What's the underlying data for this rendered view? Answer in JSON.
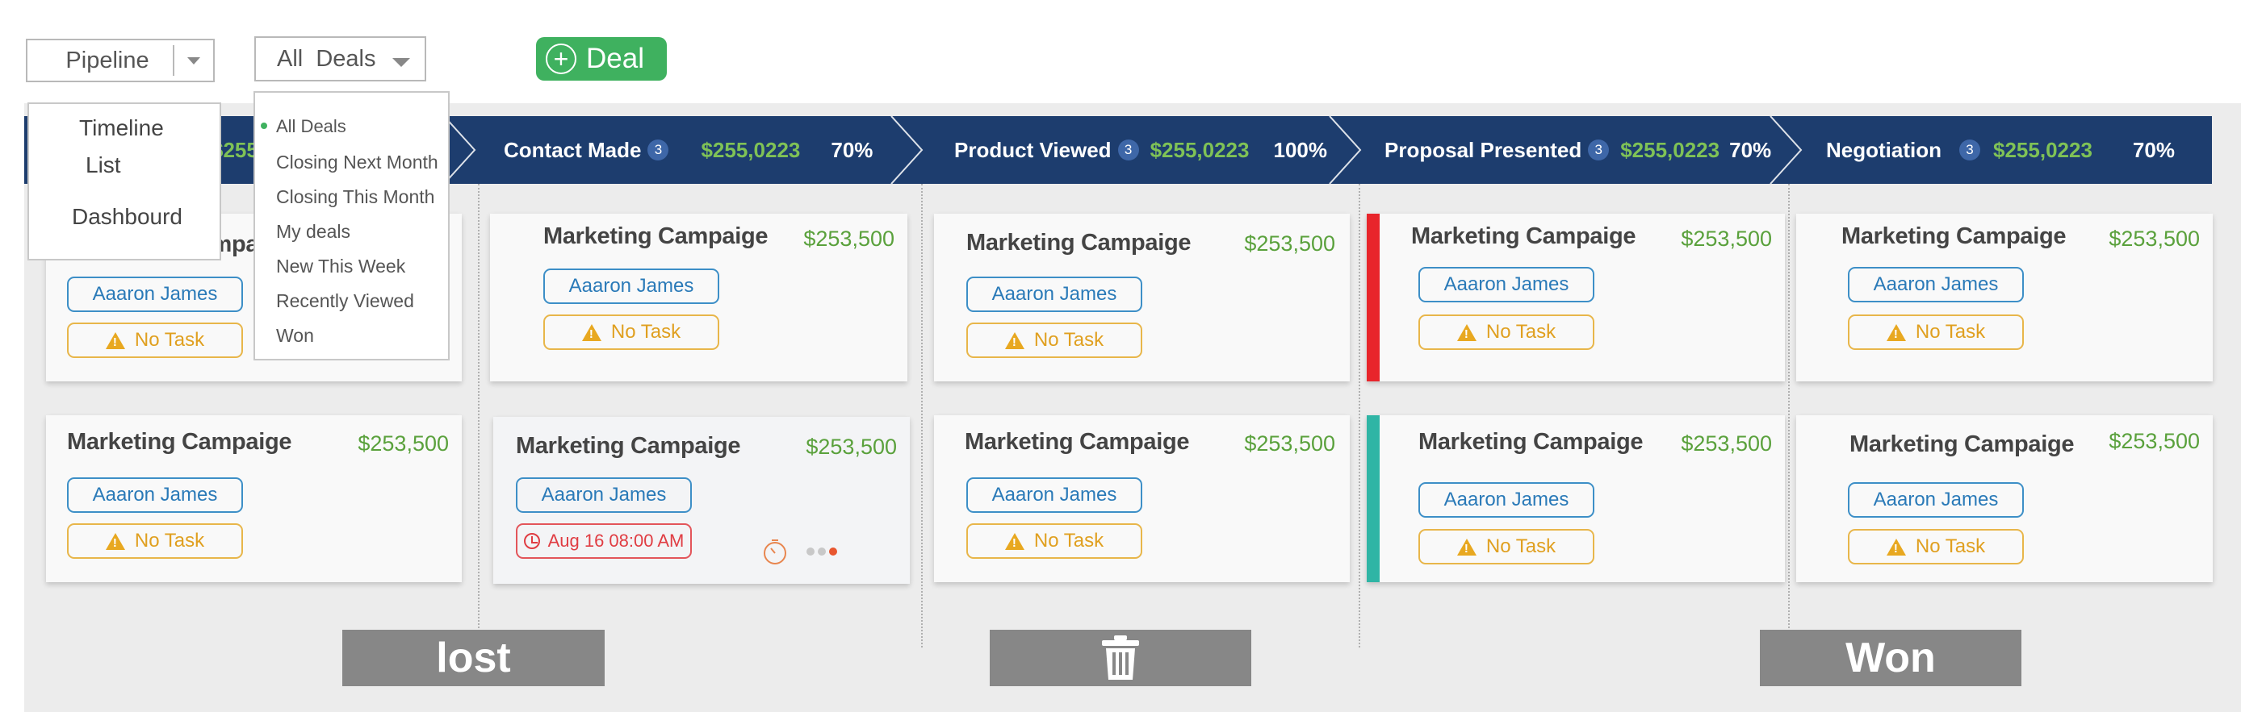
{
  "toolbar": {
    "view_select": "Pipeline",
    "filter_select": "All  Deals",
    "add_button": "Deal"
  },
  "view_menu": [
    "Timeline",
    "List",
    "Dashbourd"
  ],
  "filter_menu": [
    "All Deals",
    "Closing Next Month",
    "Closing This Month",
    "My deals",
    "New This Week",
    "Recently Viewed",
    "Won"
  ],
  "stages": [
    {
      "name": "",
      "count": "",
      "amount": "$255",
      "percent": ""
    },
    {
      "name": "Contact Made",
      "count": "3",
      "amount": "$255,0223",
      "percent": "70%"
    },
    {
      "name": "Product Viewed",
      "count": "3",
      "amount": "$255,0223",
      "percent": "100%"
    },
    {
      "name": "Proposal Presented",
      "count": "3",
      "amount": "$255,0223",
      "percent": "70%"
    },
    {
      "name": "Negotiation",
      "count": "3",
      "amount": "$255,0223",
      "percent": "70%"
    }
  ],
  "cards": [
    {
      "title": "Marketing Campaig",
      "price": "",
      "user": "Aaaron James",
      "task": "No Task"
    },
    {
      "title": "Marketing Campaige",
      "price": "$253,500",
      "user": "Aaaron James",
      "task": "No Task"
    },
    {
      "title": "Marketing Campaige",
      "price": "$253,500",
      "user": "Aaaron James",
      "task": "No Task"
    },
    {
      "title": "Marketing Campaige",
      "price": "$253,500",
      "user": "Aaaron James",
      "task": "No Task"
    },
    {
      "title": "Marketing Campaige",
      "price": "$253,500",
      "user": "Aaaron James",
      "task": "No Task"
    },
    {
      "title": "Marketing Campaige",
      "price": "$253,500",
      "user": "Aaaron James",
      "task": "No Task"
    },
    {
      "title": "Marketing Campaige",
      "price": "$253,500",
      "user": "Aaaron James",
      "task": "Aug 16 08:00 AM"
    },
    {
      "title": "Marketing Campaige",
      "price": "$253,500",
      "user": "Aaaron James",
      "task": "No Task"
    },
    {
      "title": "Marketing Campaige",
      "price": "$253,500",
      "user": "Aaaron James",
      "task": "No Task"
    },
    {
      "title": "Marketing Campaige",
      "price": "$253,500",
      "user": "Aaaron James",
      "task": "No Task"
    }
  ],
  "drop_zones": {
    "lost": "lost",
    "won": "Won"
  },
  "colors": {
    "stage_bar": "#1d3d6e",
    "amount_green": "#7fc256",
    "price_green": "#5aa13c",
    "add_button": "#3fb15f",
    "stripe_red": "#e8252b",
    "stripe_teal": "#2fb5a5",
    "drop_zone": "#878787"
  },
  "icons": {
    "add": "plus-circle-icon",
    "task": "warning-icon",
    "date": "clock-icon",
    "delete": "trash-icon"
  }
}
